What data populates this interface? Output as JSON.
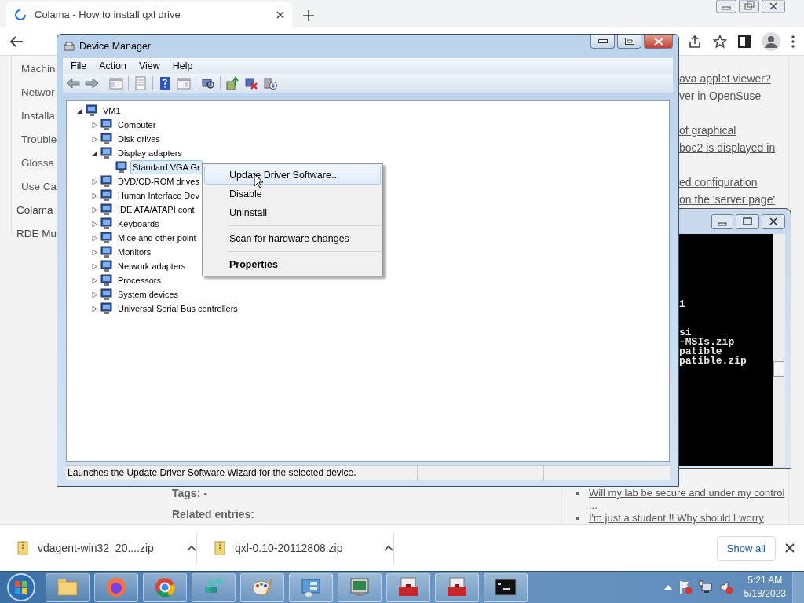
{
  "browser": {
    "tab": {
      "title": "Colama - How to install qxl drive",
      "selected": true
    },
    "sidebar_links": [
      "Machin",
      "Networ",
      "Installa",
      "Trouble",
      "Glossa",
      "Use Ca"
    ],
    "sidebar_sections": [
      "Colama",
      "RDE Mu"
    ],
    "right_link_groups": [
      [
        "ava applet viewer?",
        "ver in OpenSuse"
      ],
      [
        "of graphical",
        "boc2 is displayed in"
      ],
      [
        "ed configuration",
        "on the 'server page'"
      ]
    ],
    "tags": "Tags: -",
    "related": "Related entries:",
    "bullet_links": [
      "Will my lab be secure and under my control ...",
      "I'm just a student !! Why should I worry"
    ]
  },
  "downloads": {
    "items": [
      {
        "name": "vdagent-win32_20....zip"
      },
      {
        "name": "qxl-0.10-20112808.zip"
      }
    ],
    "show_all": "Show all"
  },
  "device_manager": {
    "title": "Device Manager",
    "menu": [
      "File",
      "Action",
      "View",
      "Help"
    ],
    "tree": {
      "label": "VM1",
      "expanded": true,
      "selected": false,
      "children": [
        {
          "label": "Computer",
          "expanded": false,
          "selected": false
        },
        {
          "label": "Disk drives",
          "expanded": false,
          "selected": false
        },
        {
          "label": "Display adapters",
          "expanded": true,
          "selected": false,
          "children": [
            {
              "label": "Standard VGA Gr",
              "selected": true
            }
          ]
        },
        {
          "label": "DVD/CD-ROM drives",
          "expanded": false,
          "selected": false
        },
        {
          "label": "Human Interface Dev",
          "expanded": false,
          "selected": false
        },
        {
          "label": "IDE ATA/ATAPI cont",
          "expanded": false,
          "selected": false
        },
        {
          "label": "Keyboards",
          "expanded": false,
          "selected": false
        },
        {
          "label": "Mice and other point",
          "expanded": false,
          "selected": false
        },
        {
          "label": "Monitors",
          "expanded": false,
          "selected": false
        },
        {
          "label": "Network adapters",
          "expanded": false,
          "selected": false
        },
        {
          "label": "Processors",
          "expanded": false,
          "selected": false
        },
        {
          "label": "System devices",
          "expanded": false,
          "selected": false
        },
        {
          "label": "Universal Serial Bus controllers",
          "expanded": false,
          "selected": false
        }
      ]
    },
    "context_menu": [
      {
        "kind": "item",
        "label": "Update Driver Software...",
        "selected": true
      },
      {
        "kind": "item",
        "label": "Disable",
        "selected": false
      },
      {
        "kind": "item",
        "label": "Uninstall",
        "selected": false
      },
      {
        "kind": "separator"
      },
      {
        "kind": "item",
        "label": "Scan for hardware changes",
        "selected": false
      },
      {
        "kind": "separator"
      },
      {
        "kind": "default",
        "label": "Properties",
        "selected": false
      }
    ],
    "status": "Launches the Update Driver Software Wizard for the selected device."
  },
  "console": {
    "blocks": [
      [
        "i"
      ],
      [
        "si",
        "-MSIs.zip",
        "patible",
        "patible.zip"
      ]
    ]
  },
  "taskbar": {
    "time": "5:21 AM",
    "date": "5/18/2023"
  }
}
